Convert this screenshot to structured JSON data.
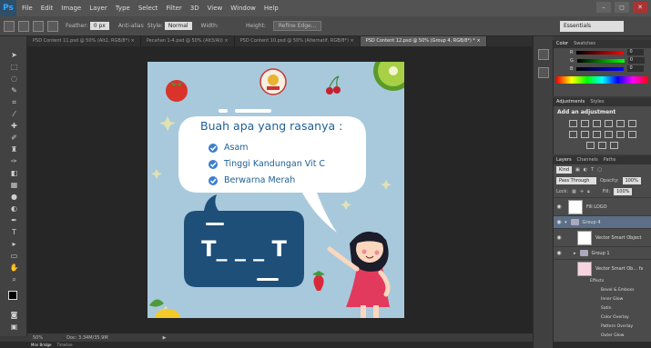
{
  "app": {
    "logo": "Ps"
  },
  "menu": [
    "File",
    "Edit",
    "Image",
    "Layer",
    "Type",
    "Select",
    "Filter",
    "3D",
    "View",
    "Window",
    "Help"
  ],
  "window_controls": [
    "–",
    "◻",
    "✕"
  ],
  "options": {
    "feather_label": "Feather:",
    "feather_value": "0 px",
    "anti_alias": "Anti-alias",
    "style_label": "Style:",
    "style_value": "Normal",
    "width_label": "Width:",
    "height_label": "Height:",
    "refine": "Refine Edge...",
    "workspace": "Essentials"
  },
  "tabs": [
    {
      "label": "PSD Content 11.psd @ 50% (Alt2, RGB/8*) ×",
      "active": false
    },
    {
      "label": "Pecahan 1-4.psd @ 50% (Alt3/Ali) ×",
      "active": false
    },
    {
      "label": "PSD Content 10.psd @ 50% (Alternatif, RGB/8*) ×",
      "active": false
    },
    {
      "label": "PSD Content 12.psd @ 50% (Group 4, RGB/8*) * ×",
      "active": true
    }
  ],
  "artboard": {
    "question": "Buah apa yang rasanya :",
    "clues": [
      "Asam",
      "Tinggi Kandungan Vit C",
      "Berwarna Merah"
    ],
    "answer": "T_ _ _ T",
    "colors": {
      "bg": "#a8c9dc",
      "navy": "#1e4f78",
      "clue": "#1d5f96",
      "check": "#3b7fd0"
    }
  },
  "status": {
    "zoom": "50%",
    "doc": "Doc: 3.34M/35.9M"
  },
  "bottom_tabs": [
    "Mini Bridge",
    "Timeline"
  ],
  "color_panel": {
    "tabs": [
      "Color",
      "Swatches"
    ],
    "rows": [
      {
        "label": "R",
        "value": "0"
      },
      {
        "label": "G",
        "value": "0"
      },
      {
        "label": "B",
        "value": "0"
      }
    ]
  },
  "adjustments": {
    "tabs": [
      "Adjustments",
      "Styles"
    ],
    "title": "Add an adjustment"
  },
  "layers_panel": {
    "tabs": [
      "Layers",
      "Channels",
      "Paths"
    ],
    "kind": "Kind",
    "blend": "Pass Through",
    "opacity_label": "Opacity:",
    "opacity_value": "100%",
    "lock_label": "Lock:",
    "fill_label": "Fill:",
    "fill_value": "100%",
    "layers": [
      {
        "name": "Fill LOGO",
        "type": "thumb"
      },
      {
        "name": "Group 4",
        "type": "group",
        "selected": true
      },
      {
        "name": "Vector Smart Object",
        "type": "thumb"
      },
      {
        "name": "Group 1",
        "type": "group"
      },
      {
        "name": "Vector Smart Ob... fx",
        "type": "thumb"
      }
    ],
    "effects_head": "Effects",
    "effects": [
      "Bevel & Emboss",
      "Inner Glow",
      "Satin",
      "Color Overlay",
      "Pattern Overlay",
      "Outer Glow"
    ]
  }
}
